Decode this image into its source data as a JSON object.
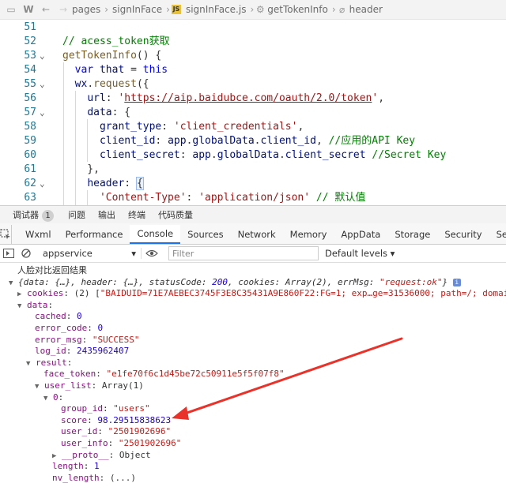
{
  "breadcrumb": {
    "items": [
      "pages",
      "signInFace",
      "signInFace.js",
      "getTokenInfo",
      "header"
    ]
  },
  "editor": {
    "lines": [
      {
        "num": "51",
        "fold": "",
        "html": ""
      },
      {
        "num": "52",
        "fold": "",
        "html": "<span class='c-comment'>// acess_token获取</span>"
      },
      {
        "num": "53",
        "fold": "⌄",
        "html": "<span class='c-fn'>getTokenInfo</span>() {"
      },
      {
        "num": "54",
        "fold": "",
        "html": "  <span class='c-kw'>var</span> <span class='c-var'>that</span> = <span class='c-kw'>this</span>"
      },
      {
        "num": "55",
        "fold": "⌄",
        "html": "  <span class='c-var'>wx</span>.<span class='c-fn'>request</span>({"
      },
      {
        "num": "56",
        "fold": "",
        "html": "    <span class='c-var'>url</span>: <span class='c-str'>'</span><span class='c-url'>https://aip.baidubce.com/oauth/2.0/token</span><span class='c-str'>'</span>,"
      },
      {
        "num": "57",
        "fold": "⌄",
        "html": "    <span class='c-var'>data</span>: {"
      },
      {
        "num": "58",
        "fold": "",
        "html": "      <span class='c-var'>grant_type</span>: <span class='c-str'>'client_credentials'</span>,"
      },
      {
        "num": "59",
        "fold": "",
        "html": "      <span class='c-var'>client_id</span>: <span class='c-var'>app</span>.<span class='c-var'>globalData</span>.<span class='c-var'>client_id</span>, <span class='c-comment'>//应用的API Key</span>"
      },
      {
        "num": "60",
        "fold": "",
        "html": "      <span class='c-var'>client_secret</span>: <span class='c-var'>app</span>.<span class='c-var'>globalData</span>.<span class='c-var'>client_secret</span> <span class='c-comment'>//Secret Key</span>"
      },
      {
        "num": "61",
        "fold": "",
        "html": "    },"
      },
      {
        "num": "62",
        "fold": "⌄",
        "html": "    <span class='c-var'>header</span>: <span class='sel-brace'>{</span>"
      },
      {
        "num": "63",
        "fold": "",
        "html": "      <span class='c-str'>'Content-Type'</span>: <span class='c-str'>'application/json'</span> <span class='c-comment'>// 默认值</span>"
      }
    ]
  },
  "devtools": {
    "tabs": [
      "调试器",
      "问题",
      "输出",
      "终端",
      "代码质量"
    ],
    "badge": "1",
    "panel_tabs": [
      "Wxml",
      "Performance",
      "Console",
      "Sources",
      "Network",
      "Memory",
      "AppData",
      "Storage",
      "Security",
      "Sensor"
    ],
    "active_panel": "Console",
    "context": "appservice",
    "filter_placeholder": "Filter",
    "levels": "Default levels"
  },
  "console": {
    "lines": [
      {
        "indent": 0,
        "tri": "",
        "cn": true,
        "html": "人脸对比返回结果"
      },
      {
        "indent": 0,
        "tri": "▼",
        "html": "<span class='it'>{data: {…}, header: {…}, statusCode: <span class='n'>200</span>, cookies: Array(2), errMsg: <span class='s'>\"request:ok\"</span>}</span> <span class='info-icon'>i</span>"
      },
      {
        "indent": 1,
        "tri": "▶",
        "html": "<span class='k'>cookies</span>: (2) [<span class='s'>\"BAIDUID=71E7AEBEC3745F3E8C35431A9E860F22:FG=1; exp…ge=31536000; path=/; domain=.baidu.</span>"
      },
      {
        "indent": 1,
        "tri": "▼",
        "html": "<span class='k'>data</span>:"
      },
      {
        "indent": 2,
        "tri": "",
        "html": "<span class='k'>cached</span>: <span class='n'>0</span>"
      },
      {
        "indent": 2,
        "tri": "",
        "html": "<span class='k'>error_code</span>: <span class='n'>0</span>"
      },
      {
        "indent": 2,
        "tri": "",
        "html": "<span class='k'>error_msg</span>: <span class='s'>\"SUCCESS\"</span>"
      },
      {
        "indent": 2,
        "tri": "",
        "html": "<span class='k'>log_id</span>: <span class='n'>2435962407</span>"
      },
      {
        "indent": 2,
        "tri": "▼",
        "html": "<span class='k'>result</span>:"
      },
      {
        "indent": 3,
        "tri": "",
        "html": "<span class='k'>face_token</span>: <span class='s'>\"e1fe70f6c1d45be72c50911e5f5f07f8\"</span>"
      },
      {
        "indent": 3,
        "tri": "▼",
        "html": "<span class='k'>user_list</span>: Array(1)"
      },
      {
        "indent": 4,
        "tri": "▼",
        "html": "<span class='k'>0</span>:"
      },
      {
        "indent": 5,
        "tri": "",
        "html": "<span class='k'>group_id</span>: <span class='s'>\"users\"</span>"
      },
      {
        "indent": 5,
        "tri": "",
        "html": "<span class='k'>score</span>: <span class='n'>98.29515838623</span>"
      },
      {
        "indent": 5,
        "tri": "",
        "html": "<span class='k'>user_id</span>: <span class='s'>\"2501902696\"</span>"
      },
      {
        "indent": 5,
        "tri": "",
        "html": "<span class='k'>user_info</span>: <span class='s'>\"2501902696\"</span>"
      },
      {
        "indent": 5,
        "tri": "▶",
        "html": "<span class='k'>__proto__</span>: Object"
      },
      {
        "indent": 4,
        "tri": "",
        "html": "<span class='k'>length</span>: <span class='n'>1</span>"
      },
      {
        "indent": 4,
        "tri": "",
        "html": "<span class='k'>nv_length</span>: (...)"
      }
    ]
  },
  "colors": {
    "annotation_arrow": "#e8322a",
    "accent": "#1a73e8"
  }
}
